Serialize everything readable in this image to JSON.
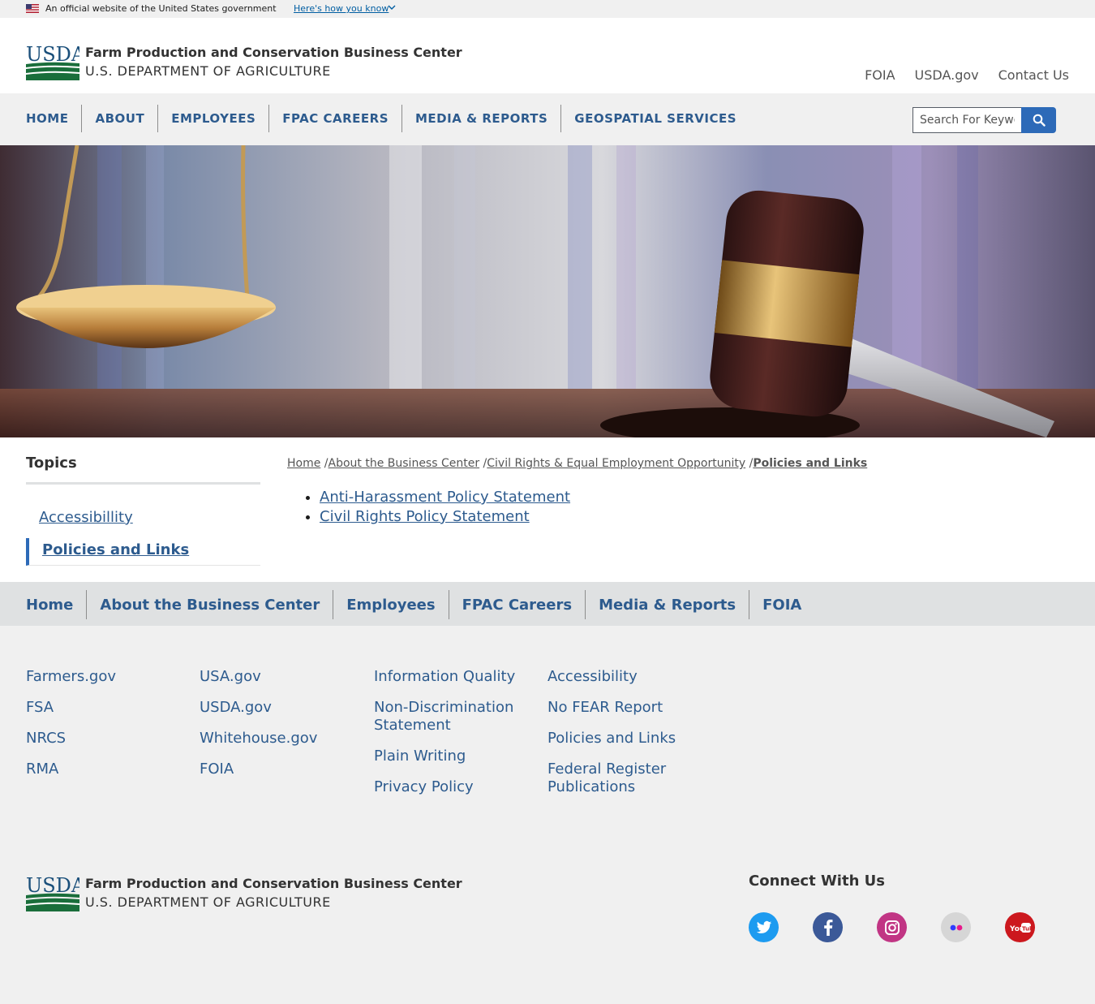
{
  "gov_banner": {
    "text": "An official website of the United States government",
    "how_link": "Here's how you know"
  },
  "header": {
    "logo_text": "USDA",
    "title": "Farm Production and Conservation Business Center",
    "subtitle": "U.S. DEPARTMENT OF AGRICULTURE",
    "utility_links": [
      "FOIA",
      "USDA.gov",
      "Contact Us"
    ]
  },
  "main_nav": {
    "items": [
      "HOME",
      "ABOUT",
      "EMPLOYEES",
      "FPAC CAREERS",
      "MEDIA & REPORTS",
      "GEOSPATIAL SERVICES"
    ],
    "search_placeholder": "Search For Keywords"
  },
  "sidebar": {
    "title": "Topics",
    "items": [
      "Accessibillity",
      "Policies and Links"
    ]
  },
  "breadcrumb": {
    "items": [
      "Home",
      "About the Business Center",
      "Civil Rights & Equal Employment Opportunity"
    ],
    "current": "Policies and Links"
  },
  "content": {
    "links": [
      "Anti-Harassment Policy Statement",
      "Civil Rights Policy Statement"
    ]
  },
  "footer_nav": {
    "items": [
      "Home",
      "About the Business Center",
      "Employees",
      "FPAC Careers",
      "Media & Reports",
      "FOIA"
    ]
  },
  "footer_links": {
    "col1": [
      "Farmers.gov",
      "FSA",
      "NRCS",
      "RMA"
    ],
    "col2": [
      "USA.gov",
      "USDA.gov",
      "Whitehouse.gov",
      "FOIA"
    ],
    "col3": [
      "Information Quality",
      "Non-Discrimination Statement",
      "Plain Writing",
      "Privacy Policy"
    ],
    "col4": [
      "Accessibility",
      "No FEAR Report",
      "Policies and Links",
      "Federal Register Publications"
    ]
  },
  "footer": {
    "title": "Farm Production and Conservation Business Center",
    "subtitle": "U.S. DEPARTMENT OF AGRICULTURE",
    "connect_title": "Connect With Us",
    "social": [
      {
        "name": "twitter-icon",
        "color": "#1d9bf0"
      },
      {
        "name": "facebook-icon",
        "color": "#3b5998"
      },
      {
        "name": "instagram-icon",
        "color": "#c13584"
      },
      {
        "name": "flickr-icon",
        "color": "#c8c8c8"
      },
      {
        "name": "youtube-icon",
        "color": "#cc181e"
      }
    ]
  },
  "colors": {
    "link_blue": "#2d5b8e",
    "usda_green": "#205493",
    "search_button": "#2d6ab8"
  }
}
